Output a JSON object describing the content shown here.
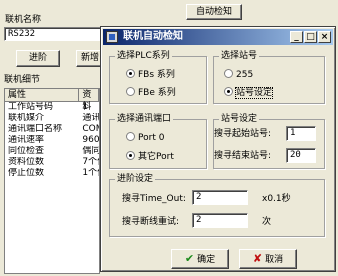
{
  "main": {
    "auto_detect_button": "自动检知",
    "machine_name_label": "联机名称",
    "machine_name_value": "RS232",
    "advanced_button": "进阶",
    "new_button": "新增",
    "detail_label": "联机细节",
    "table": {
      "headers": [
        "属性",
        "资料"
      ],
      "rows": [
        [
          "工作站号码",
          "1"
        ],
        [
          "联机媒介",
          "通讯"
        ],
        [
          "通讯端口名称",
          "COM"
        ],
        [
          "通讯速率",
          "960"
        ],
        [
          "同位检查",
          "偶同"
        ],
        [
          "资料位数",
          "7个位"
        ],
        [
          "停止位数",
          "1个位"
        ]
      ]
    }
  },
  "dialog": {
    "title": "联机自动检知",
    "title_buttons": [
      "_",
      "□",
      "×"
    ],
    "plc_series": {
      "legend": "选择PLC系列",
      "options": [
        "FBs 系列",
        "FBe 系列"
      ],
      "selected": 0
    },
    "station": {
      "legend": "选择站号",
      "options": [
        "255",
        "站号设定"
      ],
      "selected": 1
    },
    "comm_port": {
      "legend": "选择通讯端口",
      "options": [
        "Port 0",
        "其它Port"
      ],
      "selected": 1
    },
    "station_setting": {
      "legend": "站号设定",
      "start_label": "搜寻起始站号:",
      "start_value": "1",
      "end_label": "搜寻结束站号:",
      "end_value": "20"
    },
    "advanced": {
      "legend": "进阶设定",
      "timeout_label": "搜寻Time_Out:",
      "timeout_value": "2",
      "timeout_unit": "x0.1秒",
      "retry_label": "搜寻断线重试:",
      "retry_value": "2",
      "retry_unit": "次"
    },
    "ok_button": "确定",
    "cancel_button": "取消",
    "colors": {
      "title_start": "#0a246a",
      "title_end": "#a6caf0",
      "ok_icon": "#1c8a1c",
      "cancel_icon": "#c01010"
    },
    "icons": {
      "ok": "check-icon",
      "cancel": "cross-icon",
      "app": "app-icon"
    }
  }
}
